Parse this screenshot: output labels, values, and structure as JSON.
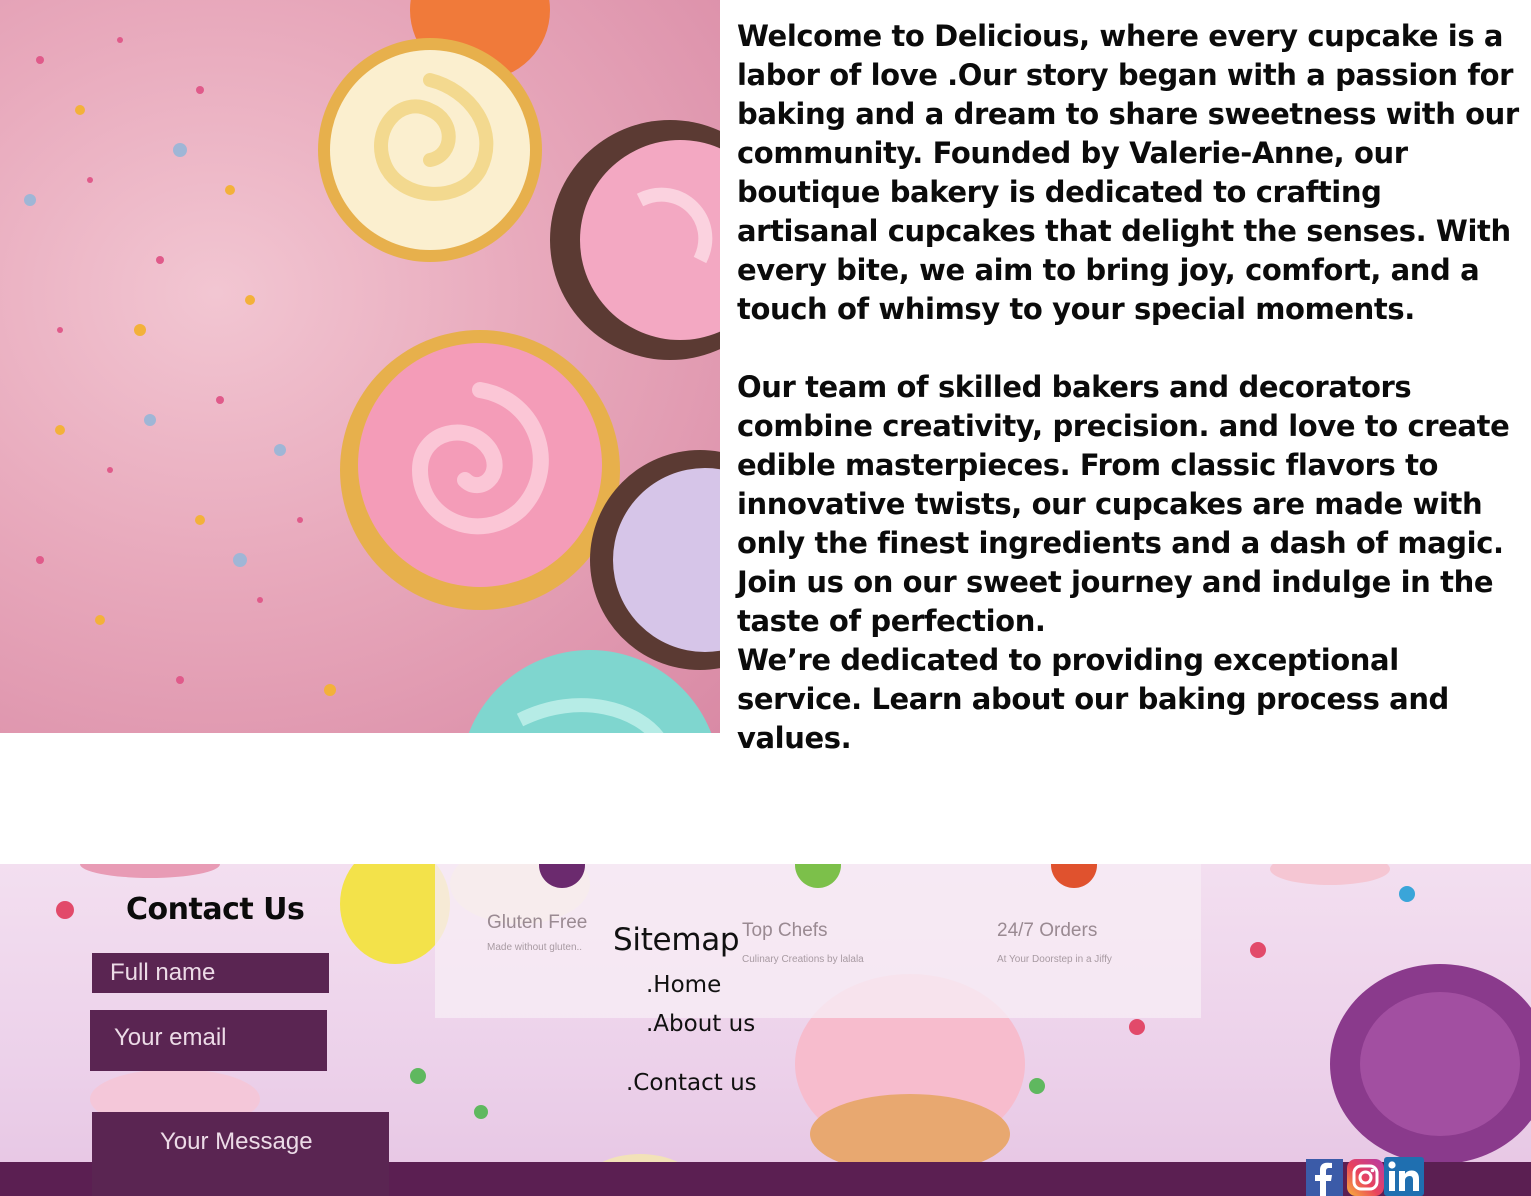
{
  "about": {
    "paragraph_1": "Welcome to Delicious, where every cupcake is a labor of love .Our story began with a passion for baking and a dream to share sweetness with our community. Founded by Valerie-Anne, our boutique bakery is dedicated to crafting artisanal cupcakes that delight the senses. With every bite, we aim to bring joy, comfort, and a touch of whimsy to your special moments.",
    "paragraph_2": "Our team of skilled bakers and decorators combine creativity, precision. and love to create edible masterpieces. From classic flavors to innovative twists, our cupcakes are made with only the finest ingredients and a dash of magic. Join us on our sweet journey and indulge in the taste of perfection.",
    "paragraph_3": "We’re dedicated to providing exceptional service. Learn about our baking process and values."
  },
  "footer": {
    "features": [
      {
        "title": "Gluten Free",
        "subtitle": "Made without gluten..",
        "icon": "cupcake-icon",
        "color": "#6b2a6e"
      },
      {
        "title": "Top Chefs",
        "subtitle": "Culinary Creations by lalala",
        "icon": "cupcake-icon",
        "color": "#7cc04a"
      },
      {
        "title": "24/7 Orders",
        "subtitle": "At Your Doorstep in a Jiffy",
        "icon": "cupcake-icon",
        "color": "#e0522e"
      }
    ],
    "contact": {
      "title": "Contact Us",
      "name_placeholder": "Full name",
      "email_placeholder": "Your email",
      "message_placeholder": "Your Message"
    },
    "sitemap": {
      "title": "Sitemap",
      "links": [
        ".Home",
        ".About us",
        ".Contact us"
      ]
    },
    "social": [
      "facebook-icon",
      "instagram-icon",
      "linkedin-icon"
    ]
  },
  "colors": {
    "field_bg": "#5a2552",
    "bottom_bar": "#5b1f52",
    "text": "#0b0b0b"
  }
}
